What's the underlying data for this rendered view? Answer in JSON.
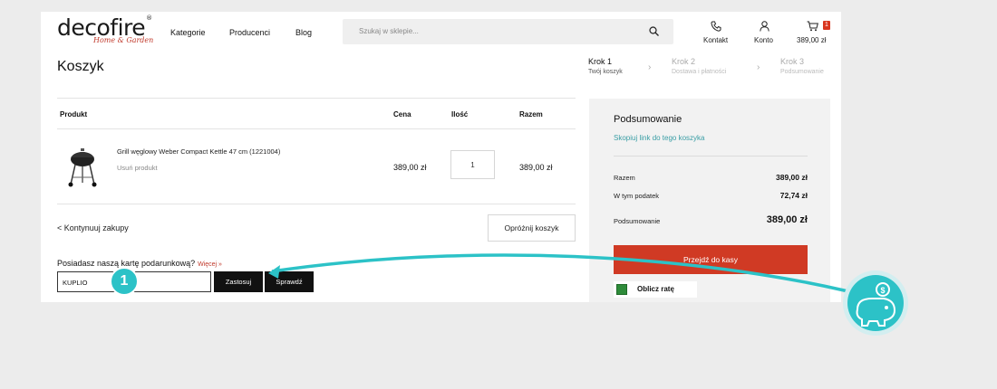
{
  "header": {
    "logo_text": "decofire",
    "logo_sub": "Home & Garden",
    "nav": [
      "Kategorie",
      "Producenci",
      "Blog"
    ],
    "search_placeholder": "Szukaj w sklepie...",
    "contact_label": "Kontakt",
    "account_label": "Konto",
    "cart_total": "389,00 zł",
    "cart_count": "1"
  },
  "page_title": "Koszyk",
  "steps": [
    {
      "title": "Krok 1",
      "sub": "Twój koszyk",
      "active": true
    },
    {
      "title": "Krok 2",
      "sub": "Dostawa i płatności",
      "active": false
    },
    {
      "title": "Krok 3",
      "sub": "Podsumowanie",
      "active": false
    }
  ],
  "table": {
    "headers": {
      "product": "Produkt",
      "price": "Cena",
      "qty": "Ilość",
      "total": "Razem"
    },
    "rows": [
      {
        "name": "Grill węglowy Weber Compact Kettle 47 cm (1221004)",
        "remove": "Usuń produkt",
        "price": "389,00 zł",
        "qty": "1",
        "total": "389,00 zł"
      }
    ]
  },
  "continue_label": "< Kontynuuj zakupy",
  "empty_cart_label": "Opróżnij koszyk",
  "gift_card": {
    "question": "Posiadasz naszą kartę podarunkową?",
    "more": "Więcej »",
    "input_value": "KUPLIO",
    "apply_label": "Zastosuj",
    "check_label": "Sprawdź"
  },
  "summary": {
    "title": "Podsumowanie",
    "copy_link": "Skopiuj link do tego koszyka",
    "rows": [
      {
        "label": "Razem",
        "value": "389,00 zł"
      },
      {
        "label": "W tym podatek",
        "value": "72,74 zł"
      }
    ],
    "total_label": "Podsumowanie",
    "total_value": "389,00 zł",
    "checkout_label": "Przejdź do kasy",
    "installment_label": "Oblicz ratę"
  },
  "annotation": {
    "step_number": "1"
  },
  "colors": {
    "accent_teal": "#2cc2c7",
    "brand_red": "#d03a24",
    "link_teal": "#3a9ea5"
  }
}
